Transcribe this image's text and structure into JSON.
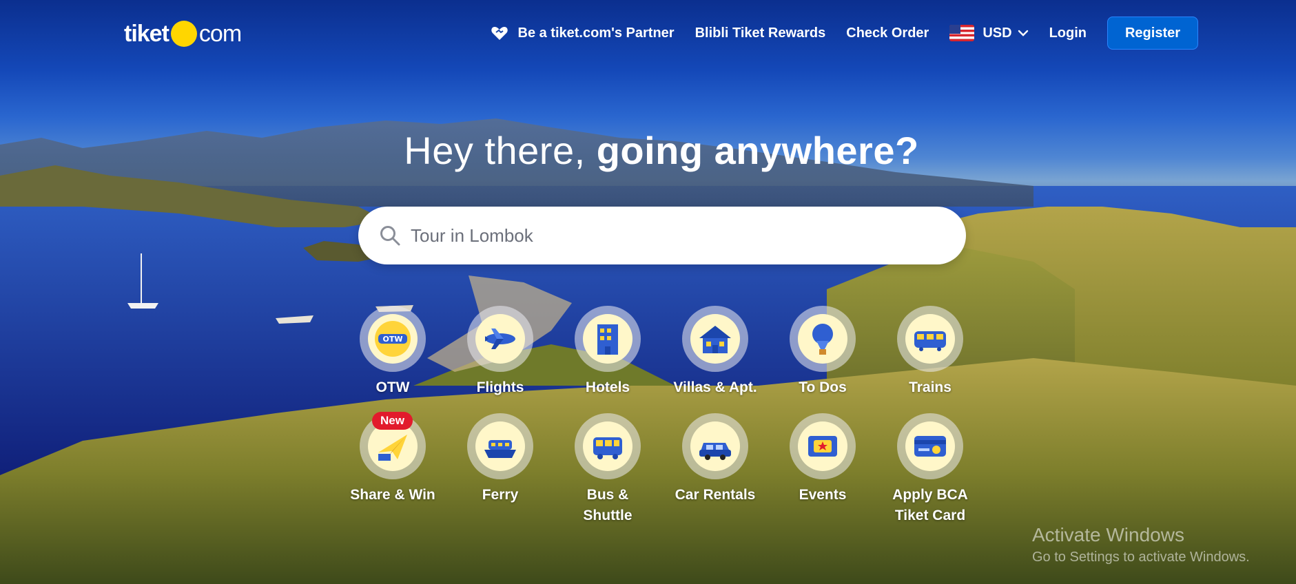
{
  "header": {
    "logo": {
      "text_left": "tiket",
      "text_right": "com"
    },
    "nav": {
      "partner_label": "Be a tiket.com's Partner",
      "rewards_label": "Blibli Tiket Rewards",
      "check_order_label": "Check Order",
      "currency_label": "USD",
      "login_label": "Login",
      "register_label": "Register"
    }
  },
  "hero": {
    "headline_light": "Hey there, ",
    "headline_bold": "going anywhere?",
    "search": {
      "placeholder": "Tour in Lombok"
    }
  },
  "categories": [
    {
      "label": "OTW",
      "icon": "otw-icon"
    },
    {
      "label": "Flights",
      "icon": "airplane-icon"
    },
    {
      "label": "Hotels",
      "icon": "hotel-icon"
    },
    {
      "label": "Villas & Apt.",
      "icon": "villa-icon"
    },
    {
      "label": "To Dos",
      "icon": "hot-air-balloon-icon"
    },
    {
      "label": "Trains",
      "icon": "train-icon"
    },
    {
      "label": "Share & Win",
      "icon": "paper-plane-icon",
      "badge": "New"
    },
    {
      "label": "Ferry",
      "icon": "ferry-icon"
    },
    {
      "label": "Bus &",
      "label2": "Shuttle",
      "icon": "bus-icon"
    },
    {
      "label": "Car Rentals",
      "icon": "car-icon"
    },
    {
      "label": "Events",
      "icon": "ticket-icon"
    },
    {
      "label": "Apply BCA",
      "label2": "Tiket Card",
      "icon": "credit-card-icon"
    }
  ],
  "watermark": {
    "title": "Activate Windows",
    "subtitle": "Go to Settings to activate Windows."
  },
  "colors": {
    "brand_blue": "#0064d2",
    "logo_yellow": "#ffd600",
    "badge_red": "#e21b2c"
  }
}
